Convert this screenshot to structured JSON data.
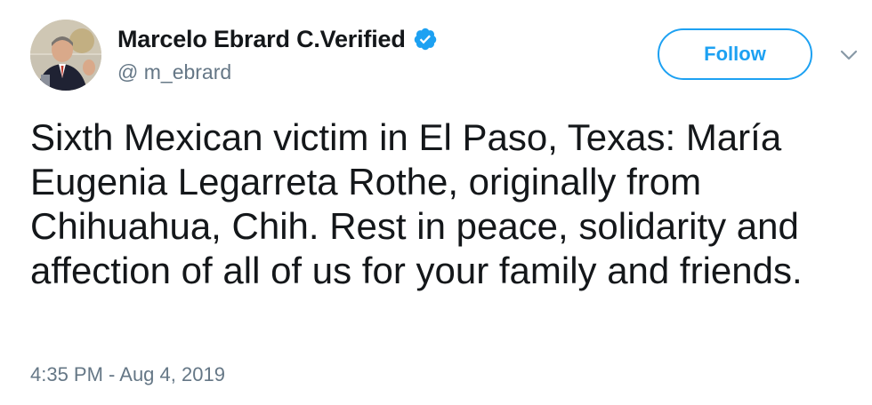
{
  "author": {
    "display_name": "Marcelo Ebrard C.Verified",
    "handle": "@ m_ebrard",
    "verified": true
  },
  "header": {
    "follow_label": "Follow"
  },
  "tweet": {
    "text": "Sixth Mexican victim in El Paso, Texas: María Eugenia Legarreta Rothe, originally from Chihuahua, Chih. Rest in peace, solidarity and affection of all of us for your family and friends.",
    "timestamp": "4:35 PM - Aug 4, 2019"
  },
  "icons": {
    "verified": "verified-badge-icon",
    "caret": "chevron-down-icon",
    "avatar": "profile-photo"
  },
  "colors": {
    "accent": "#1da1f2",
    "muted_text": "#657786",
    "primary_text": "#14171a"
  }
}
